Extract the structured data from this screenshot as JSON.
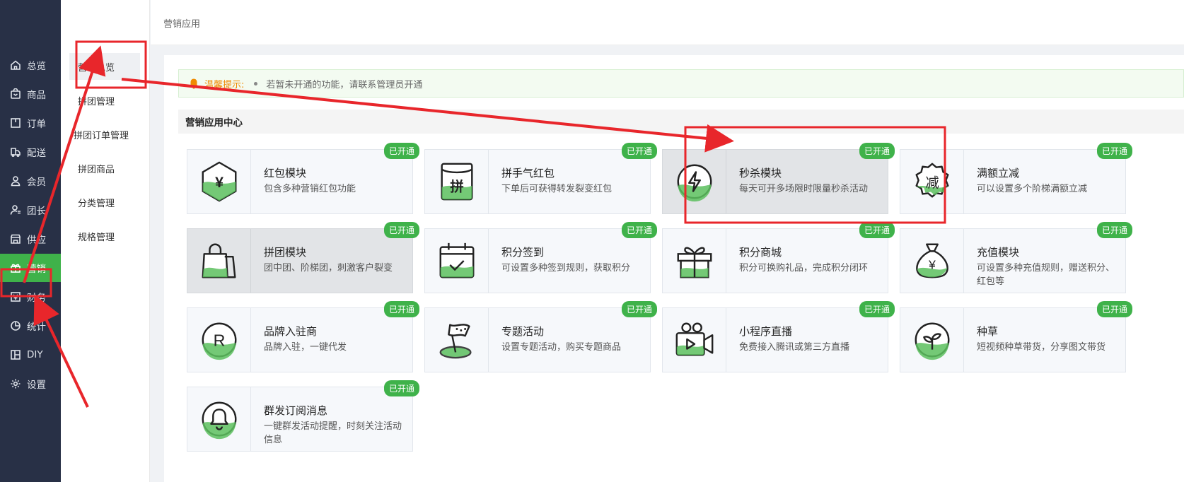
{
  "nav": {
    "items": [
      {
        "label": "总览",
        "icon": "home-icon"
      },
      {
        "label": "商品",
        "icon": "bag-icon"
      },
      {
        "label": "订单",
        "icon": "order-icon"
      },
      {
        "label": "配送",
        "icon": "delivery-icon"
      },
      {
        "label": "会员",
        "icon": "user-icon"
      },
      {
        "label": "团长",
        "icon": "leader-icon"
      },
      {
        "label": "供应",
        "icon": "store-icon"
      },
      {
        "label": "营销",
        "icon": "gift-icon"
      },
      {
        "label": "财务",
        "icon": "finance-icon"
      },
      {
        "label": "统计",
        "icon": "pie-icon"
      },
      {
        "label": "DIY",
        "icon": "diy-icon"
      },
      {
        "label": "设置",
        "icon": "gear-icon"
      }
    ],
    "active_index": 7
  },
  "subnav": {
    "items": [
      "营销总览",
      "拼团管理",
      "拼团订单管理",
      "拼团商品",
      "分类管理",
      "规格管理"
    ],
    "active_index": 0
  },
  "header": {
    "breadcrumb": "营销应用"
  },
  "tip": {
    "label": "温馨提示:",
    "text": "若暂未开通的功能，请联系管理员开通"
  },
  "section": {
    "title": "营销应用中心"
  },
  "colors": {
    "accent": "#3fb24a",
    "sidebar": "#283046",
    "annotation": "#e8262b",
    "warning": "#f08a00"
  },
  "cards": [
    {
      "title": "红包模块",
      "desc": "包含多种营销红包功能",
      "badge": "已开通",
      "icon": "red-packet-icon"
    },
    {
      "title": "拼手气红包",
      "desc": "下单后可获得转发裂变红包",
      "badge": "已开通",
      "icon": "lucky-packet-icon"
    },
    {
      "title": "秒杀模块",
      "desc": "每天可开多场限时限量秒杀活动",
      "badge": "已开通",
      "icon": "flash-sale-icon"
    },
    {
      "title": "满额立减",
      "desc": "可以设置多个阶梯满额立减",
      "badge": "已开通",
      "icon": "discount-icon"
    },
    {
      "title": "拼团模块",
      "desc": "团中团、阶梯团，刺激客户裂变",
      "badge": "已开通",
      "icon": "group-buy-icon"
    },
    {
      "title": "积分签到",
      "desc": "可设置多种签到规则，获取积分",
      "badge": "已开通",
      "icon": "calendar-check-icon"
    },
    {
      "title": "积分商城",
      "desc": "积分可换购礼品，完成积分闭环",
      "badge": "已开通",
      "icon": "gift-box-icon"
    },
    {
      "title": "充值模块",
      "desc": "可设置多种充值规则，赠送积分、红包等",
      "badge": "已开通",
      "icon": "money-bag-icon"
    },
    {
      "title": "品牌入驻商",
      "desc": "品牌入驻，一键代发",
      "badge": "已开通",
      "icon": "brand-icon"
    },
    {
      "title": "专题活动",
      "desc": "设置专题活动，购买专题商品",
      "badge": "已开通",
      "icon": "flag-icon"
    },
    {
      "title": "小程序直播",
      "desc": "免费接入腾讯或第三方直播",
      "badge": "已开通",
      "icon": "live-camera-icon"
    },
    {
      "title": "种草",
      "desc": "短视频种草带货，分享图文带货",
      "badge": "已开通",
      "icon": "sprout-icon"
    },
    {
      "title": "群发订阅消息",
      "desc": "一键群发活动提醒，时刻关注活动信息",
      "badge": "已开通",
      "icon": "bell-icon"
    }
  ]
}
